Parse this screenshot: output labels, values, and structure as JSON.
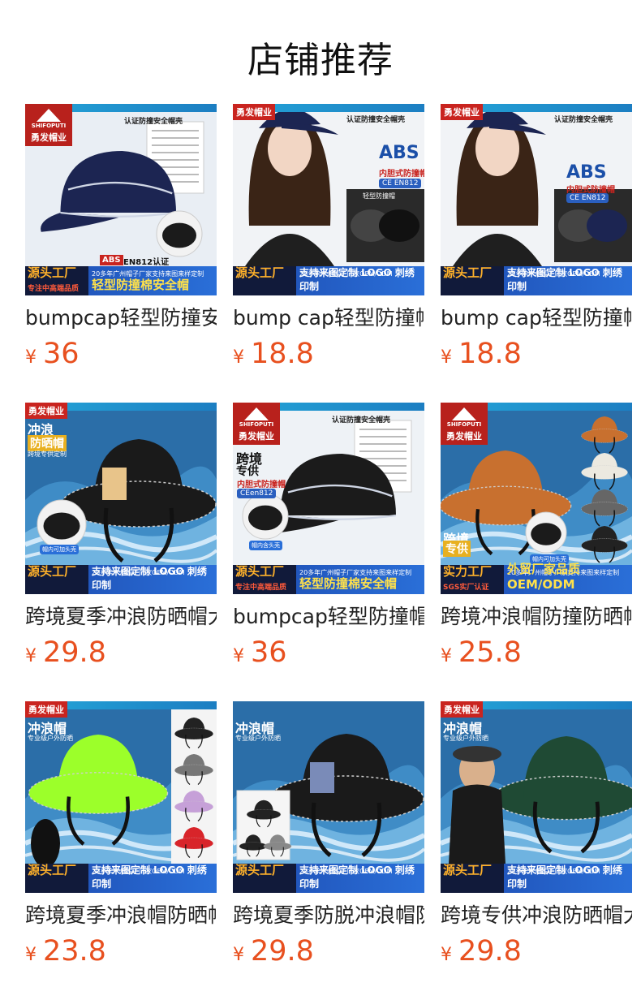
{
  "page_title": "店铺推荐",
  "currency": "¥",
  "products": [
    {
      "name": "bumpcap轻型防撞安全帽",
      "price": "36",
      "image": {
        "style": "navy-cap-box",
        "badge": "勇发帽业",
        "logo": "SHIFOPUTI",
        "cert_title": "认证防撞安全帽壳",
        "abs": "ABS",
        "abs_suffix": "EN812认证",
        "source": "源头工厂",
        "source_sub": "专注中高端品质",
        "bottom_top": "20多年广州帽子厂家支持来图来样定制",
        "bottom_main": "轻型防撞棉安全帽",
        "bg": "#e9eef4",
        "hat": "#1c2552"
      }
    },
    {
      "name": "bump cap轻型防撞帽",
      "price": "18.8",
      "image": {
        "style": "model-navy",
        "badge": "勇发帽业",
        "cert_title": "认证防撞安全帽壳",
        "abs": "ABS",
        "abs_sub": "内胆式防撞帽",
        "ce": "CE EN812",
        "insert_label": "轻型防撞帽",
        "source": "源头工厂",
        "bottom_top": "20多年广州帽子厂家OEM/ODM",
        "bottom_main": "支持来图定制 LOGO 刺绣 印制",
        "bg": "#f1f3f6",
        "hat": "#1c2552"
      }
    },
    {
      "name": "bump cap轻型防撞帽",
      "price": "18.8",
      "image": {
        "style": "model-navy-2",
        "badge": "勇发帽业",
        "cert_title": "认证防撞安全帽壳",
        "abs": "ABS",
        "abs_sub": "内胆式防撞帽",
        "ce": "CE EN812",
        "source": "源头工厂",
        "bottom_top": "20多年广州帽子厂家OEM/ODM",
        "bottom_main": "支持来图定制 LOGO 刺绣 印制",
        "bg": "#f1f3f6",
        "hat": "#1c2552"
      }
    },
    {
      "name": "跨境夏季冲浪防晒帽大檐",
      "price": "29.8",
      "image": {
        "style": "bucket-wave",
        "badge": "勇发帽业",
        "headline": "冲浪",
        "headline2": "防晒帽",
        "sub": "跨境专供定制",
        "note": "帽内可加头壳",
        "source": "源头工厂",
        "bottom_top": "20多年广州帽子厂家OEM/ODM",
        "bottom_main": "支持来图定制 LOGO 刺绣 印制",
        "bg": "#2c6fa8",
        "hat": "#1a1a1a"
      }
    },
    {
      "name": "bumpcap轻型防撞帽壳",
      "price": "36",
      "image": {
        "style": "black-cap-box",
        "logo": "SHIFOPUTI",
        "badge": "勇发帽业",
        "cert_title": "认证防撞安全帽壳",
        "headline": "跨境",
        "headline2": "专供",
        "abs_sub": "内胆式防撞帽",
        "ce": "CEen812",
        "note": "帽内含头壳",
        "source": "源头工厂",
        "source_sub": "专注中高端品质",
        "bottom_top": "20多年广州帽子厂家支持来图来样定制",
        "bottom_main": "轻型防撞棉安全帽",
        "bg": "#eef2f6",
        "hat": "#1b1b1b"
      }
    },
    {
      "name": "跨境冲浪帽防撞防晒帽",
      "price": "25.8",
      "image": {
        "style": "orange-bucket",
        "logo": "SHIFOPUTI",
        "badge": "勇发帽业",
        "headline": "跨境",
        "headline2": "专供",
        "note": "帽内可加头壳",
        "source": "实力工厂",
        "source_sub": "SGS实厂认证",
        "bottom_top": "20多年广州帽子厂家支持来图来样定制",
        "bottom_main": "外贸厂家品质OEM/ODM",
        "bg": "#2e7bb4",
        "hat": "#c8702f"
      }
    },
    {
      "name": "跨境夏季冲浪帽防晒帽",
      "price": "23.8",
      "image": {
        "style": "neon-bucket",
        "badge": "勇发帽业",
        "headline": "冲浪帽",
        "sub": "专业级户外防晒",
        "source": "源头工厂",
        "bottom_top": "20多年广州帽子厂家OEM/ODM",
        "bottom_main": "支持来图定制 LOGO 刺绣 印制",
        "bg": "#3b86c0",
        "hat": "#9cff2a"
      }
    },
    {
      "name": "跨境夏季防脱冲浪帽防晒",
      "price": "29.8",
      "image": {
        "style": "black-bucket",
        "headline": "冲浪帽",
        "sub": "专业级户外防晒",
        "source": "源头工厂",
        "bottom_top": "20多年广州帽子厂家OEM/ODM",
        "bottom_main": "支持来图定制 LOGO 刺绣 印制",
        "bg": "#2f78b4",
        "hat": "#1a1a1a"
      }
    },
    {
      "name": "跨境专供冲浪防晒帽大檐",
      "price": "29.8",
      "image": {
        "style": "green-bucket",
        "badge": "勇发帽业",
        "headline": "冲浪帽",
        "sub": "专业级户外防晒",
        "source": "源头工厂",
        "bottom_top": "20多年广州帽子厂家OEM/ODM",
        "bottom_main": "支持来图定制 LOGO 刺绣 印制",
        "bg": "#2f78b4",
        "hat": "#1f4a34"
      }
    }
  ]
}
